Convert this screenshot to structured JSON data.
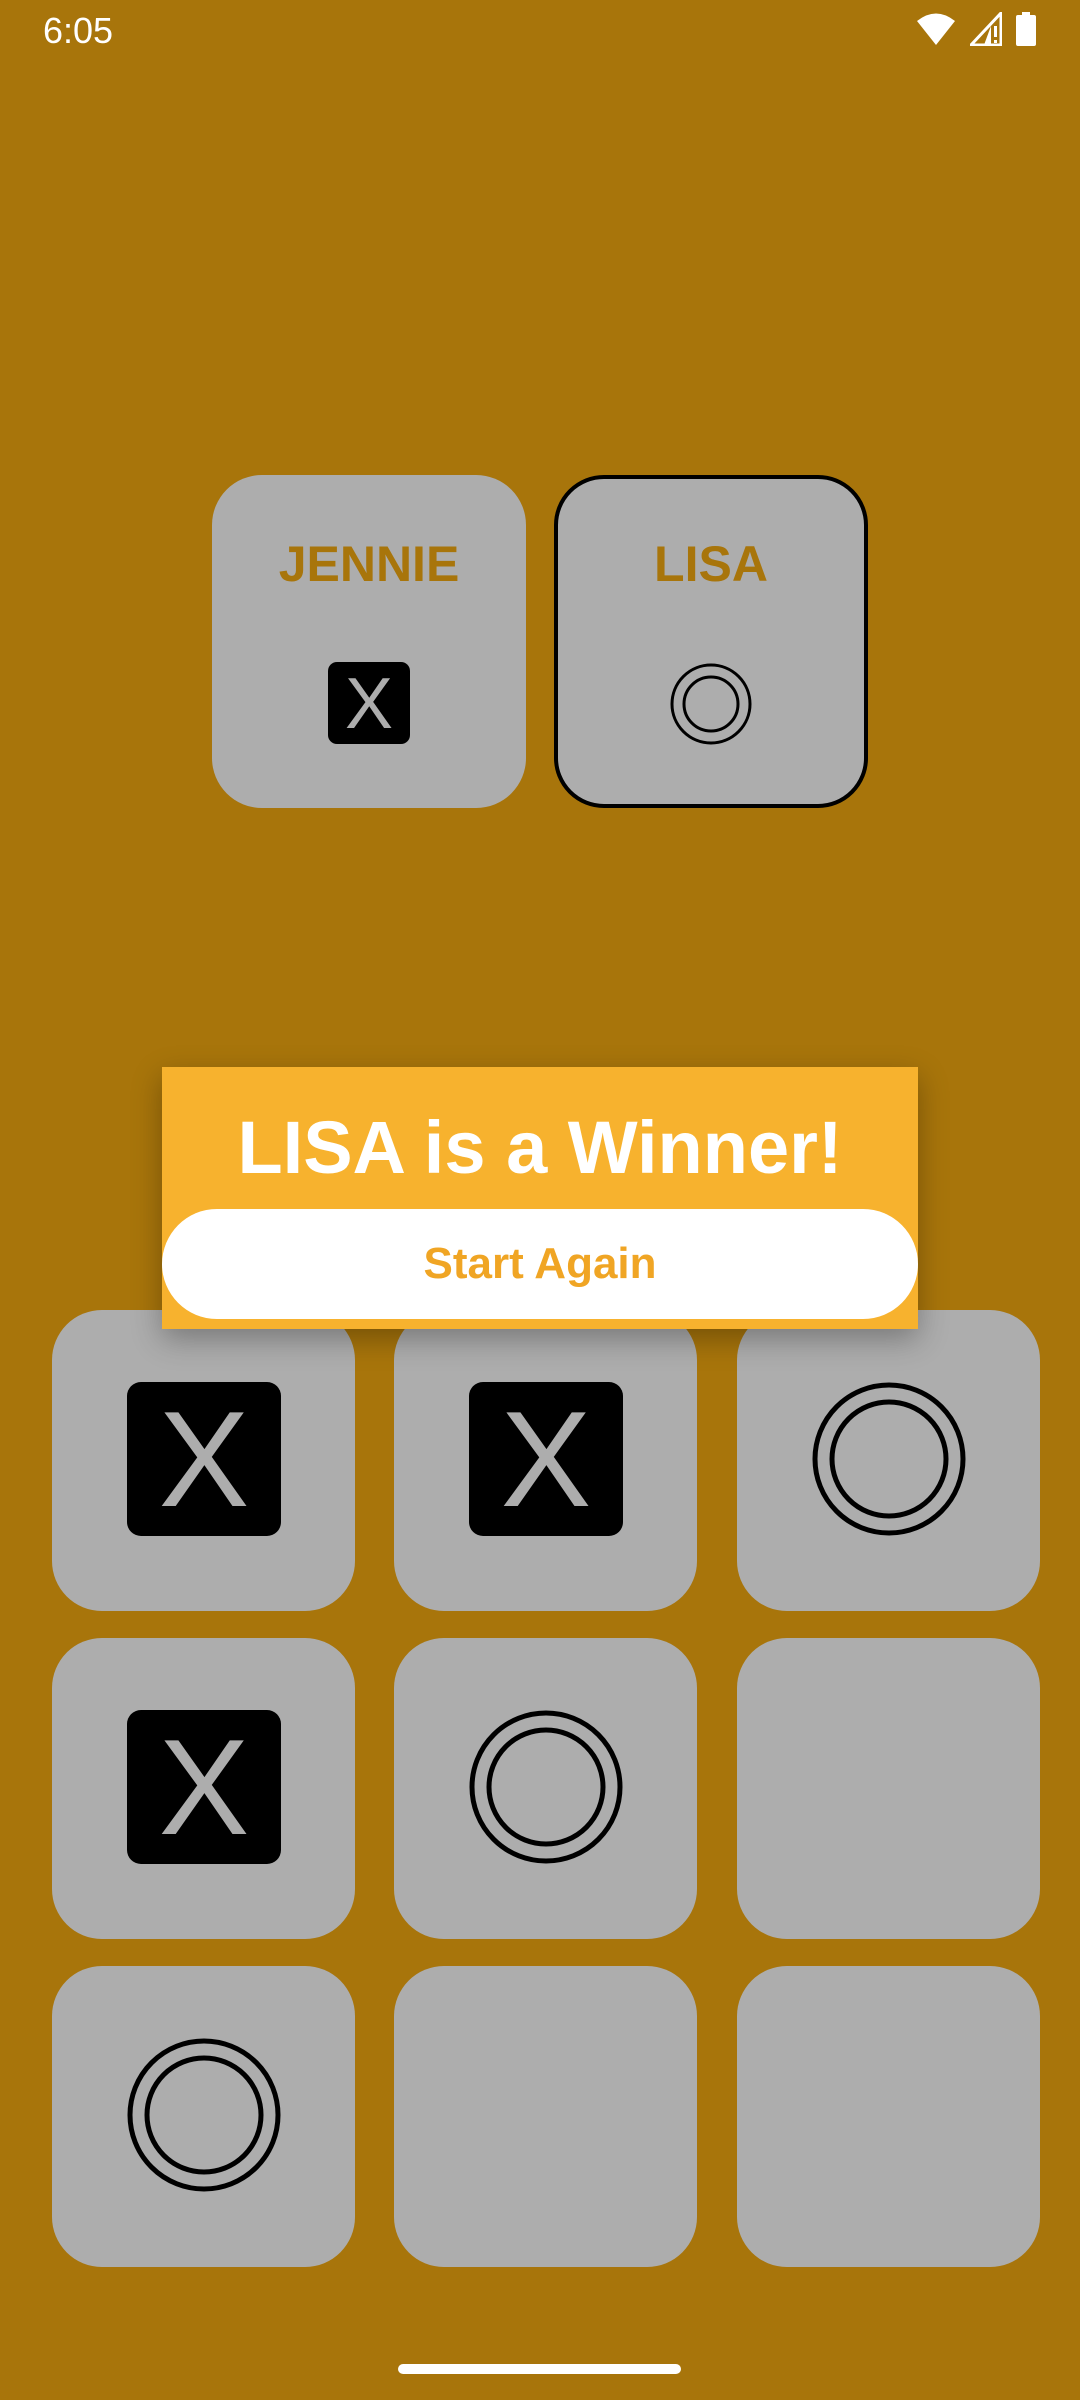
{
  "status_bar": {
    "time": "6:05",
    "icons": [
      "wifi-icon",
      "cell-signal-icon",
      "battery-icon"
    ]
  },
  "players": [
    {
      "name": "JENNIE",
      "symbol": "x-icon",
      "active": false
    },
    {
      "name": "LISA",
      "symbol": "o-icon",
      "active": true
    }
  ],
  "dialog": {
    "title": "LISA is a Winner!",
    "button_label": "Start Again"
  },
  "board": [
    [
      "X",
      "X",
      "O"
    ],
    [
      "X",
      "O",
      ""
    ],
    [
      "O",
      "",
      ""
    ]
  ],
  "colors": {
    "background": "#A8750B",
    "tile": "#ADADAD",
    "dialog": "#F7B22E",
    "accent_text": "#F0A524"
  }
}
